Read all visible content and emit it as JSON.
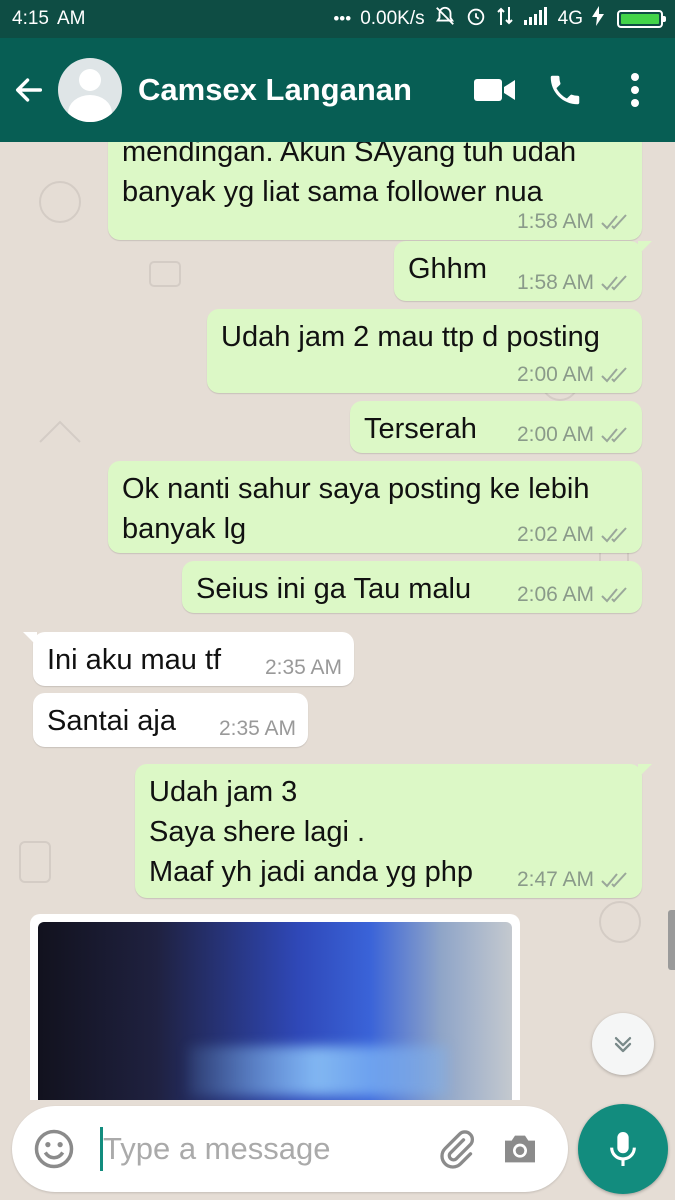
{
  "status_bar": {
    "time": "4:15",
    "ampm": "AM",
    "network_speed": "0.00K/s",
    "network_type": "4G",
    "battery_color": "#43d449"
  },
  "app_bar": {
    "contact_name": "Camsex Langanan",
    "background": "#075e54"
  },
  "messages": [
    {
      "direction": "out",
      "text": "mendingan. Akun SAyang tuh udah\nbanyak yg liat sama follower nua",
      "time": "1:58 AM",
      "ticks": "read"
    },
    {
      "direction": "out",
      "text": "Ghhm",
      "time": "1:58 AM",
      "ticks": "read"
    },
    {
      "direction": "out",
      "text": "Udah jam 2 mau ttp d posting",
      "time": "2:00 AM",
      "ticks": "read"
    },
    {
      "direction": "out",
      "text": "Terserah",
      "time": "2:00 AM",
      "ticks": "read"
    },
    {
      "direction": "out",
      "text": "Ok nanti sahur saya posting ke lebih\nbanyak lg",
      "time": "2:02 AM",
      "ticks": "read"
    },
    {
      "direction": "out",
      "text": "Seius ini ga Tau malu",
      "time": "2:06 AM",
      "ticks": "read"
    },
    {
      "direction": "in",
      "text": "Ini aku mau tf",
      "time": "2:35 AM"
    },
    {
      "direction": "in",
      "text": "Santai aja",
      "time": "2:35 AM"
    },
    {
      "direction": "out",
      "text": "Udah jam 3\nSaya shere lagi .\nMaaf yh jadi anda yg php",
      "time": "2:47 AM",
      "ticks": "read"
    }
  ],
  "composer": {
    "placeholder": "Type a message",
    "accent": "#128c7e"
  },
  "icons": {
    "back": "arrow-left-icon",
    "video": "video-camera-icon",
    "call": "phone-icon",
    "menu": "more-vert-icon",
    "emoji": "emoji-icon",
    "attach": "paperclip-icon",
    "camera": "camera-icon",
    "mic": "mic-icon",
    "scroll_down": "chevrons-down-icon"
  },
  "colors": {
    "outgoing_bubble": "#dcf8c6",
    "incoming_bubble": "#ffffff",
    "chat_background": "#e5ddd5"
  }
}
